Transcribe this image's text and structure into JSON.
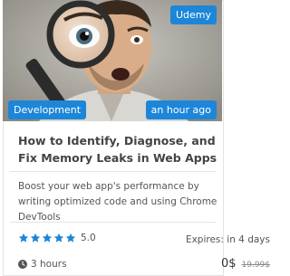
{
  "course": {
    "provider": "Udemy",
    "category": "Development",
    "posted": "an hour ago",
    "title": "How to Identify, Diagnose, and Fix Memory Leaks in Web Apps",
    "description": "Boost your web app's performance by writing optimized code and using Chrome DevTools",
    "rating": "5.0",
    "rating_stars": 5,
    "expires": "Expires: in 4 days",
    "duration": "3 hours",
    "price_now": "0$",
    "price_old": "19.99$"
  },
  "colors": {
    "badge": "#1d86d8",
    "star": "#1d86d8"
  },
  "icons": {
    "rating": "star-icon",
    "duration": "clock-icon"
  }
}
